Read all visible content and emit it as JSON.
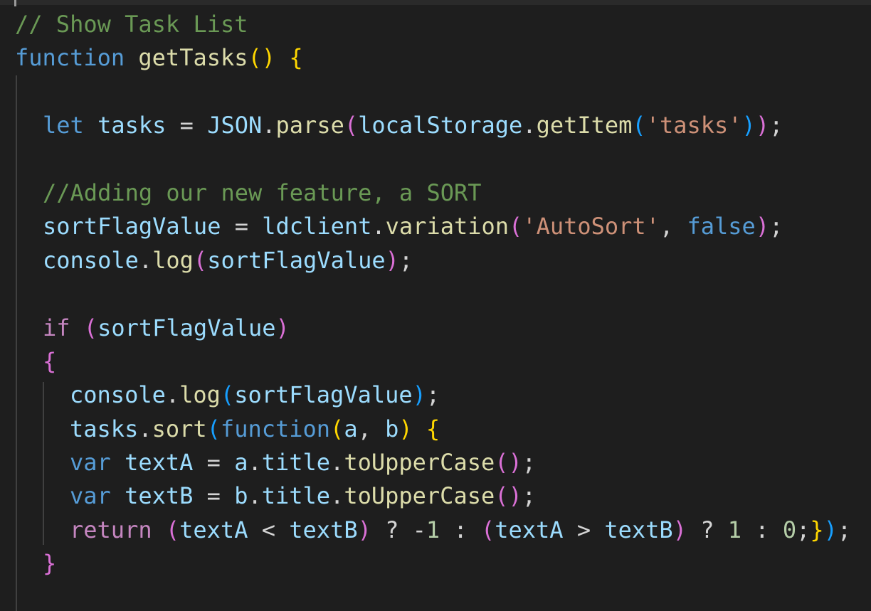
{
  "colors": {
    "background": "#1e1e1e",
    "comment": "#6a9955",
    "keyword": "#569cd6",
    "control": "#c586c0",
    "function": "#dcdcaa",
    "variable": "#9cdcfe",
    "class": "#4ec9b0",
    "string": "#ce9178",
    "number": "#b5cea8",
    "punctuation": "#d4d4d4",
    "bracket1": "#ffd700",
    "bracket2": "#da70d6",
    "bracket3": "#179fff"
  },
  "lines": [
    {
      "indent": 0,
      "tokens": [
        {
          "t": "// Show Task List",
          "c": "comment"
        }
      ]
    },
    {
      "indent": 0,
      "tokens": [
        {
          "t": "function",
          "c": "keyword"
        },
        {
          "t": " ",
          "c": "punct"
        },
        {
          "t": "getTasks",
          "c": "func"
        },
        {
          "t": "()",
          "c": "br1"
        },
        {
          "t": " ",
          "c": "punct"
        },
        {
          "t": "{",
          "c": "br1"
        }
      ]
    },
    {
      "indent": 0,
      "tokens": []
    },
    {
      "indent": 1,
      "tokens": [
        {
          "t": "let",
          "c": "keyword"
        },
        {
          "t": " ",
          "c": "punct"
        },
        {
          "t": "tasks",
          "c": "var"
        },
        {
          "t": " = ",
          "c": "punct"
        },
        {
          "t": "JSON",
          "c": "var"
        },
        {
          "t": ".",
          "c": "punct"
        },
        {
          "t": "parse",
          "c": "func"
        },
        {
          "t": "(",
          "c": "br2"
        },
        {
          "t": "localStorage",
          "c": "var"
        },
        {
          "t": ".",
          "c": "punct"
        },
        {
          "t": "getItem",
          "c": "func"
        },
        {
          "t": "(",
          "c": "br3"
        },
        {
          "t": "'tasks'",
          "c": "string"
        },
        {
          "t": ")",
          "c": "br3"
        },
        {
          "t": ")",
          "c": "br2"
        },
        {
          "t": ";",
          "c": "punct"
        }
      ]
    },
    {
      "indent": 0,
      "tokens": []
    },
    {
      "indent": 1,
      "tokens": [
        {
          "t": "//Adding our new feature, a SORT",
          "c": "comment"
        }
      ]
    },
    {
      "indent": 1,
      "tokens": [
        {
          "t": "sortFlagValue",
          "c": "var"
        },
        {
          "t": " = ",
          "c": "punct"
        },
        {
          "t": "ldclient",
          "c": "var"
        },
        {
          "t": ".",
          "c": "punct"
        },
        {
          "t": "variation",
          "c": "func"
        },
        {
          "t": "(",
          "c": "br2"
        },
        {
          "t": "'AutoSort'",
          "c": "string"
        },
        {
          "t": ", ",
          "c": "punct"
        },
        {
          "t": "false",
          "c": "keyword"
        },
        {
          "t": ")",
          "c": "br2"
        },
        {
          "t": ";",
          "c": "punct"
        }
      ]
    },
    {
      "indent": 1,
      "tokens": [
        {
          "t": "console",
          "c": "var"
        },
        {
          "t": ".",
          "c": "punct"
        },
        {
          "t": "log",
          "c": "func"
        },
        {
          "t": "(",
          "c": "br2"
        },
        {
          "t": "sortFlagValue",
          "c": "var"
        },
        {
          "t": ")",
          "c": "br2"
        },
        {
          "t": ";",
          "c": "punct"
        }
      ]
    },
    {
      "indent": 0,
      "tokens": []
    },
    {
      "indent": 1,
      "tokens": [
        {
          "t": "if",
          "c": "control"
        },
        {
          "t": " ",
          "c": "punct"
        },
        {
          "t": "(",
          "c": "br2"
        },
        {
          "t": "sortFlagValue",
          "c": "var"
        },
        {
          "t": ")",
          "c": "br2"
        }
      ]
    },
    {
      "indent": 1,
      "tokens": [
        {
          "t": "{",
          "c": "br2"
        }
      ]
    },
    {
      "indent": 2,
      "tokens": [
        {
          "t": "console",
          "c": "var"
        },
        {
          "t": ".",
          "c": "punct"
        },
        {
          "t": "log",
          "c": "func"
        },
        {
          "t": "(",
          "c": "br3"
        },
        {
          "t": "sortFlagValue",
          "c": "var"
        },
        {
          "t": ")",
          "c": "br3"
        },
        {
          "t": ";",
          "c": "punct"
        }
      ]
    },
    {
      "indent": 2,
      "tokens": [
        {
          "t": "tasks",
          "c": "var"
        },
        {
          "t": ".",
          "c": "punct"
        },
        {
          "t": "sort",
          "c": "func"
        },
        {
          "t": "(",
          "c": "br3"
        },
        {
          "t": "function",
          "c": "keyword"
        },
        {
          "t": "(",
          "c": "br1"
        },
        {
          "t": "a",
          "c": "var"
        },
        {
          "t": ", ",
          "c": "punct"
        },
        {
          "t": "b",
          "c": "var"
        },
        {
          "t": ")",
          "c": "br1"
        },
        {
          "t": " ",
          "c": "punct"
        },
        {
          "t": "{",
          "c": "br1"
        }
      ]
    },
    {
      "indent": 2,
      "tokens": [
        {
          "t": "var",
          "c": "keyword"
        },
        {
          "t": " ",
          "c": "punct"
        },
        {
          "t": "textA",
          "c": "var"
        },
        {
          "t": " = ",
          "c": "punct"
        },
        {
          "t": "a",
          "c": "var"
        },
        {
          "t": ".",
          "c": "punct"
        },
        {
          "t": "title",
          "c": "var"
        },
        {
          "t": ".",
          "c": "punct"
        },
        {
          "t": "toUpperCase",
          "c": "func"
        },
        {
          "t": "()",
          "c": "br2"
        },
        {
          "t": ";",
          "c": "punct"
        }
      ]
    },
    {
      "indent": 2,
      "tokens": [
        {
          "t": "var",
          "c": "keyword"
        },
        {
          "t": " ",
          "c": "punct"
        },
        {
          "t": "textB",
          "c": "var"
        },
        {
          "t": " = ",
          "c": "punct"
        },
        {
          "t": "b",
          "c": "var"
        },
        {
          "t": ".",
          "c": "punct"
        },
        {
          "t": "title",
          "c": "var"
        },
        {
          "t": ".",
          "c": "punct"
        },
        {
          "t": "toUpperCase",
          "c": "func"
        },
        {
          "t": "()",
          "c": "br2"
        },
        {
          "t": ";",
          "c": "punct"
        }
      ]
    },
    {
      "indent": 2,
      "tokens": [
        {
          "t": "return",
          "c": "control"
        },
        {
          "t": " ",
          "c": "punct"
        },
        {
          "t": "(",
          "c": "br2"
        },
        {
          "t": "textA",
          "c": "var"
        },
        {
          "t": " < ",
          "c": "punct"
        },
        {
          "t": "textB",
          "c": "var"
        },
        {
          "t": ")",
          "c": "br2"
        },
        {
          "t": " ? -",
          "c": "punct"
        },
        {
          "t": "1",
          "c": "number"
        },
        {
          "t": " : ",
          "c": "punct"
        },
        {
          "t": "(",
          "c": "br2"
        },
        {
          "t": "textA",
          "c": "var"
        },
        {
          "t": " > ",
          "c": "punct"
        },
        {
          "t": "textB",
          "c": "var"
        },
        {
          "t": ")",
          "c": "br2"
        },
        {
          "t": " ? ",
          "c": "punct"
        },
        {
          "t": "1",
          "c": "number"
        },
        {
          "t": " : ",
          "c": "punct"
        },
        {
          "t": "0",
          "c": "number"
        },
        {
          "t": ";",
          "c": "punct"
        },
        {
          "t": "}",
          "c": "br1"
        },
        {
          "t": ")",
          "c": "br3"
        },
        {
          "t": ";",
          "c": "punct"
        }
      ]
    },
    {
      "indent": 1,
      "tokens": [
        {
          "t": "}",
          "c": "br2"
        }
      ]
    }
  ]
}
